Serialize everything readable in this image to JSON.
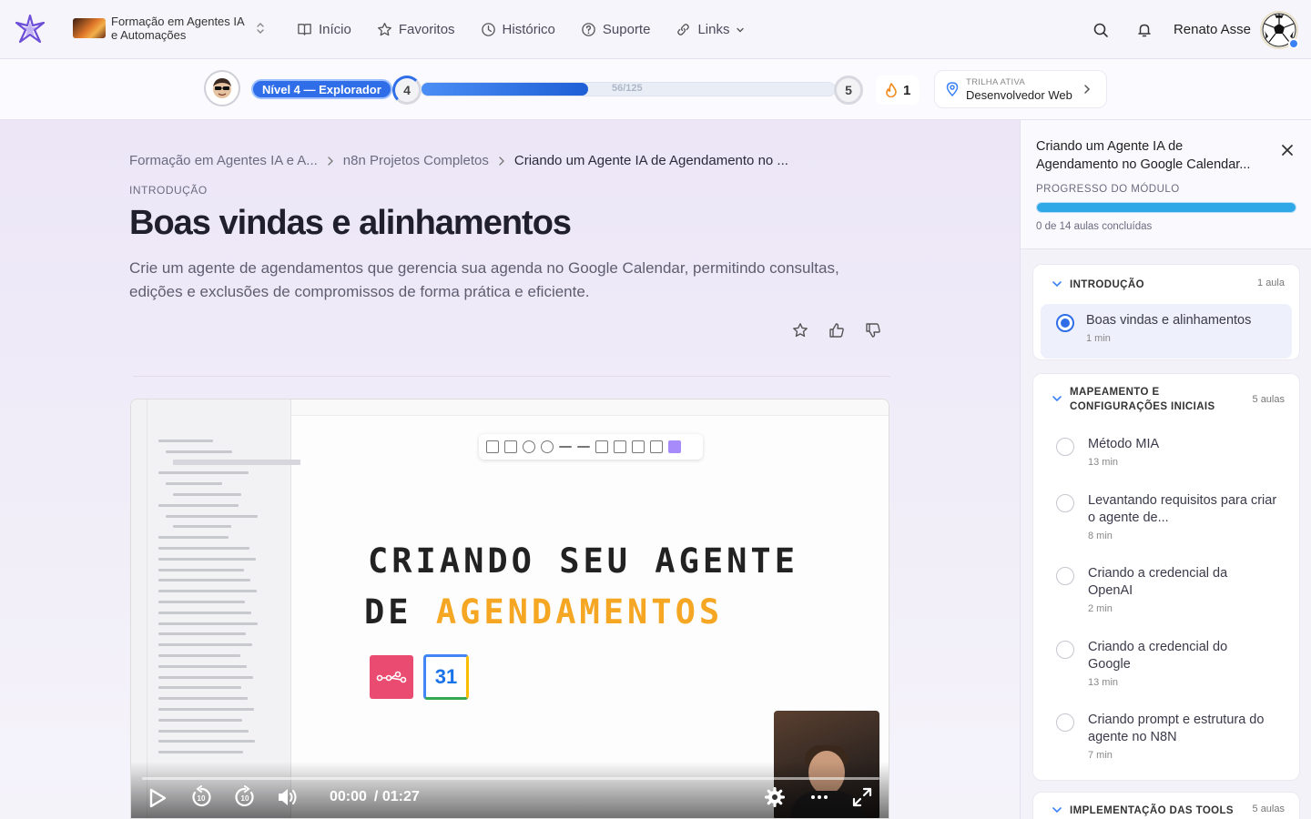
{
  "header": {
    "course_name": "Formação em Agentes IA e Automações",
    "nav": [
      {
        "label": "Início",
        "icon": "book-icon"
      },
      {
        "label": "Favoritos",
        "icon": "star-icon"
      },
      {
        "label": "Histórico",
        "icon": "clock-icon"
      },
      {
        "label": "Suporte",
        "icon": "help-icon"
      },
      {
        "label": "Links",
        "icon": "link-icon"
      }
    ],
    "user_name": "Renato Asse"
  },
  "levelbar": {
    "level_label": "Nível 4 — Explorador",
    "current_level": "4",
    "next_level": "5",
    "xp_text": "56/125",
    "xp_current": 56,
    "xp_max": 125,
    "streak": "1",
    "track_label": "TRILHA ATIVA",
    "track_value": "Desenvolvedor Web"
  },
  "breadcrumb": [
    "Formação em Agentes IA e A...",
    "n8n Projetos Completos",
    "Criando um Agente IA de Agendamento no ..."
  ],
  "lesson": {
    "section": "INTRODUÇÃO",
    "title": "Boas vindas e alinhamentos",
    "description": "Crie um agente de agendamentos que gerencia sua agenda no Google Calendar, permitindo consultas, edições e exclusões de compromissos de forma prática e eficiente."
  },
  "video": {
    "heading_line1": "CRIANDO SEU AGENTE",
    "heading_line2_prefix": "DE ",
    "heading_line2_highlight": "AGENDAMENTOS",
    "calendar_number": "31",
    "current_time": "00:00",
    "total_time": "/ 01:27",
    "progress": 0.0
  },
  "sidebar": {
    "title": "Criando um Agente IA de Agendamento no Google Calendar...",
    "progress_label": "PROGRESSO DO MÓDULO",
    "progress_text": "0 de 14 aulas concluídas",
    "progress_value": 1.0,
    "modules": [
      {
        "name": "INTRODUÇÃO",
        "count": "1 aula",
        "lessons": [
          {
            "title": "Boas vindas e alinhamentos",
            "duration": "1 min",
            "active": true
          }
        ]
      },
      {
        "name": "MAPEAMENTO E CONFIGURAÇÕES INICIAIS",
        "count": "5 aulas",
        "lessons": [
          {
            "title": "Método MIA",
            "duration": "13 min"
          },
          {
            "title": "Levantando requisitos para criar o agente de...",
            "duration": "8 min"
          },
          {
            "title": "Criando a credencial da OpenAI",
            "duration": "2 min"
          },
          {
            "title": "Criando a credencial do Google",
            "duration": "13 min"
          },
          {
            "title": "Criando prompt e estrutura do agente no N8N",
            "duration": "7 min"
          }
        ]
      },
      {
        "name": "IMPLEMENTAÇÃO DAS TOOLS",
        "count": "5 aulas",
        "lessons": []
      }
    ]
  }
}
